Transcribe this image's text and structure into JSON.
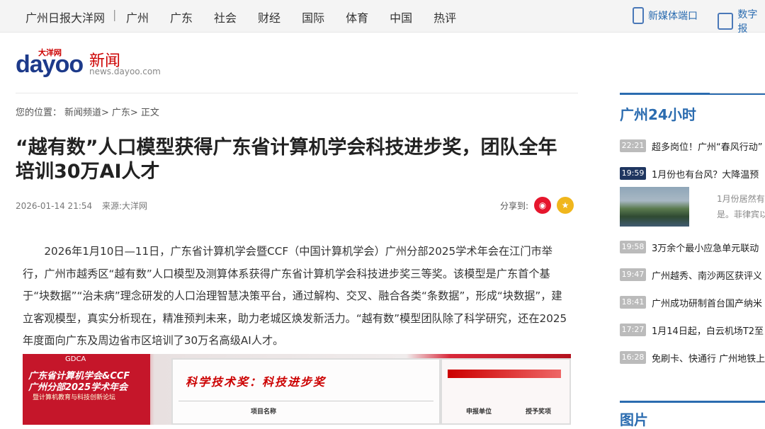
{
  "topnav": {
    "site": "广州日报大洋网",
    "sep": "|",
    "links": [
      "广州",
      "广东",
      "社会",
      "财经",
      "国际",
      "体育",
      "中国",
      "热评"
    ],
    "portal1": "新媒体端口",
    "portal2": "数字报"
  },
  "logo": {
    "small": "大洋网",
    "big": "dayoo",
    "news": "新闻",
    "domain": "news.dayoo.com"
  },
  "breadcrumb": {
    "prefix": "您的位置：",
    "items": [
      "新闻频道>",
      "广东>",
      "正文"
    ]
  },
  "article": {
    "title": "“越有数”人口模型获得广东省计算机学会科技进步奖，团队全年培训30万AI人才",
    "date": "2026-01-14 21:54",
    "source": "来源:大洋网",
    "share_label": "分享到:",
    "body": "2026年1月10日—11日，广东省计算机学会暨CCF（中国计算机学会）广州分部2025学术年会在江门市举行，广州市越秀区“越有数”人口模型及测算体系获得广东省计算机学会科技进步奖三等奖。该模型是广东首个基于“块数据”“治未病”理念研发的人口治理智慧决策平台，通过解构、交叉、融合各类“条数据”，形成“块数据”，建立客观模型，真实分析现在，精准预判未来，助力老城区焕发新活力。“越有数”模型团队除了科学研究，还在2025年度面向广东及周边省市区培训了30万名高级AI人才。"
  },
  "photo": {
    "banner_line1": "广东省计算机学会&CCF",
    "banner_line2": "广州分部2025学术年会",
    "banner_line3": "暨计算机教育与科技创新论坛",
    "banner_logo": "GDCA",
    "screen_heading": "科学技术奖：科技进步奖",
    "col1": "项目名称",
    "col2": "申报单位",
    "col3": "授予奖项"
  },
  "sidebar": {
    "heading": "广州24小时",
    "items": [
      {
        "time": "22:21",
        "text": "超多岗位！广州“春风行动”",
        "dark": false
      },
      {
        "time": "19:59",
        "text": "1月份也有台风？大降温预",
        "dark": true
      },
      {
        "time": "19:58",
        "text": "3万余个最小应急单元联动",
        "dark": false
      },
      {
        "time": "19:47",
        "text": "广州越秀、南沙两区获评义",
        "dark": false
      },
      {
        "time": "18:41",
        "text": "广州成功研制首台国产纳米",
        "dark": false
      },
      {
        "time": "17:27",
        "text": "1月14日起，白云机场T2至",
        "dark": false
      },
      {
        "time": "16:28",
        "text": "免刷卡、快通行 广州地铁上",
        "dark": false
      }
    ],
    "thumb_text_line1": "1月份居然有",
    "thumb_text_line2": "是。菲律宾以",
    "heading2": "图片"
  }
}
